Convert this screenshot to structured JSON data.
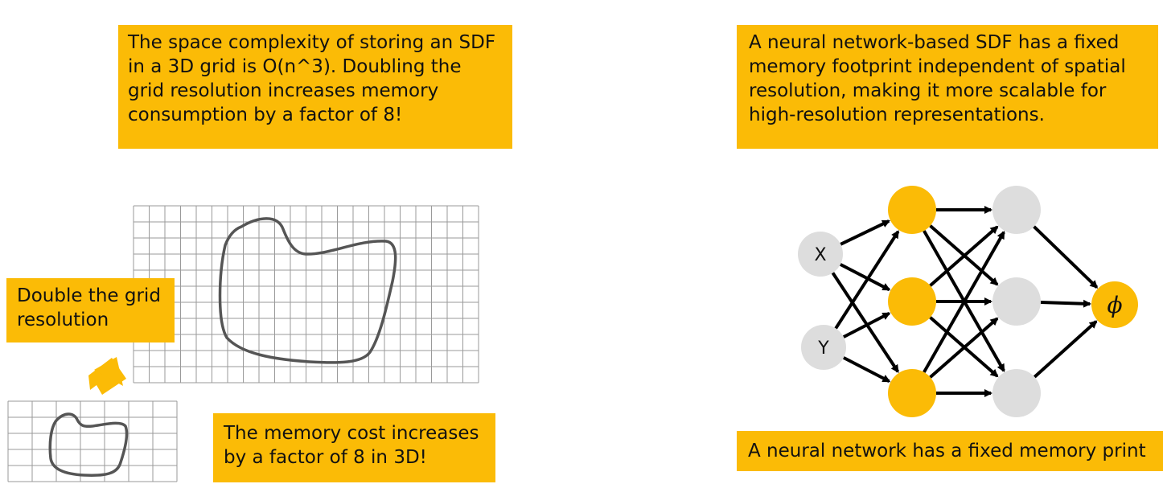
{
  "notes": {
    "top_left": "The space complexity of storing an SDF in a 3D grid is O(n^3). Doubling the grid resolution increases memory consumption by a factor of 8!",
    "top_right": "A neural network-based SDF has a fixed memory footprint independent of spatial resolution, making it more scalable for high-resolution representations.",
    "double": "Double the grid resolution",
    "memory": "The memory cost increases by a factor of 8 in 3D!",
    "fixed": "A neural network has a fixed memory print"
  },
  "network": {
    "input_labels": [
      "X",
      "Y"
    ],
    "output_label": "ϕ",
    "layer_sizes": [
      2,
      3,
      3,
      1
    ],
    "colors": {
      "orange": "#fbbb06",
      "gray": "#dddddd"
    }
  },
  "colors": {
    "accent": "#fbbb06",
    "grid": "#9a9a9a",
    "shape": "#555555"
  }
}
